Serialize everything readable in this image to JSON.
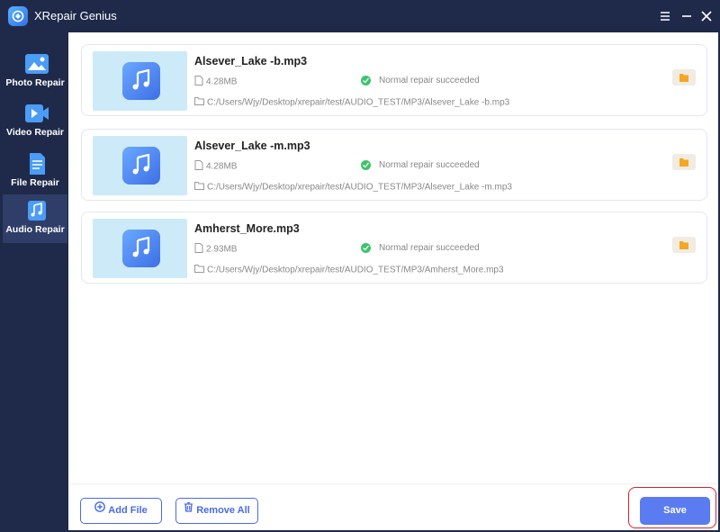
{
  "app": {
    "title": "XRepair Genius"
  },
  "sidebar": {
    "items": [
      {
        "label": "Photo Repair",
        "icon": "photo-icon",
        "active": false
      },
      {
        "label": "Video Repair",
        "icon": "video-icon",
        "active": false
      },
      {
        "label": "File Repair",
        "icon": "file-icon",
        "active": false
      },
      {
        "label": "Audio Repair",
        "icon": "music-note-icon",
        "active": true
      }
    ]
  },
  "files": [
    {
      "name": "Alsever_Lake -b.mp3",
      "size": "4.28MB",
      "status": "Normal repair succeeded",
      "path": "C:/Users/Wjy/Desktop/xrepair/test/AUDIO_TEST/MP3/Alsever_Lake -b.mp3"
    },
    {
      "name": "Alsever_Lake -m.mp3",
      "size": "4.28MB",
      "status": "Normal repair succeeded",
      "path": "C:/Users/Wjy/Desktop/xrepair/test/AUDIO_TEST/MP3/Alsever_Lake -m.mp3"
    },
    {
      "name": "Amherst_More.mp3",
      "size": "2.93MB",
      "status": "Normal repair succeeded",
      "path": "C:/Users/Wjy/Desktop/xrepair/test/AUDIO_TEST/MP3/Amherst_More.mp3"
    }
  ],
  "footer": {
    "add_label": "Add File",
    "remove_label": "Remove All",
    "save_label": "Save"
  },
  "colors": {
    "accent": "#5b7cf0",
    "sidebar": "#1f2a4a",
    "success": "#3cc46a",
    "highlight": "#d8232a"
  }
}
